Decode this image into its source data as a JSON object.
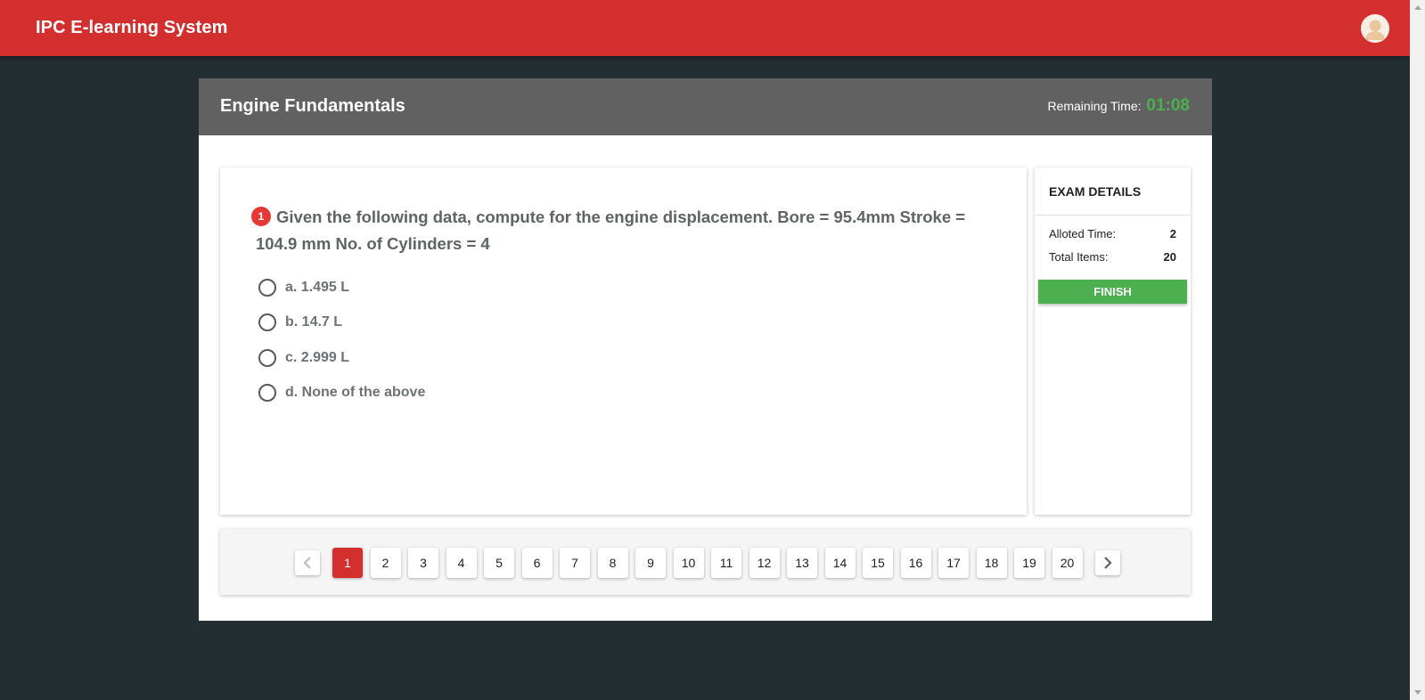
{
  "app": {
    "title": "IPC E-learning System"
  },
  "exam": {
    "title": "Engine Fundamentals",
    "remaining_time_label": "Remaining Time:",
    "remaining_time_value": "01:08"
  },
  "question": {
    "number": "1",
    "text": "Given the following data, compute for the engine displacement. Bore = 95.4mm Stroke = 104.9 mm No. of Cylinders = 4",
    "options": [
      {
        "label": "a. 1.495 L"
      },
      {
        "label": "b. 14.7 L"
      },
      {
        "label": "c. 2.999 L"
      },
      {
        "label": "d. None of the above"
      }
    ]
  },
  "details": {
    "title": "EXAM DETAILS",
    "alloted_time_label": "Alloted Time:",
    "alloted_time_value": "2",
    "total_items_label": "Total Items:",
    "total_items_value": "20",
    "finish_label": "FINISH"
  },
  "pagination": {
    "pages": [
      "1",
      "2",
      "3",
      "4",
      "5",
      "6",
      "7",
      "8",
      "9",
      "10",
      "11",
      "12",
      "13",
      "14",
      "15",
      "16",
      "17",
      "18",
      "19",
      "20"
    ],
    "active": "1"
  },
  "colors": {
    "brand": "#d32f2f",
    "header_gray": "#616161",
    "timer_green": "#4caf50",
    "finish_green": "#4caf50",
    "background": "#232e33"
  },
  "icons": {
    "prev": "chevron-left-icon",
    "next": "chevron-right-icon",
    "avatar": "user-avatar-icon"
  }
}
